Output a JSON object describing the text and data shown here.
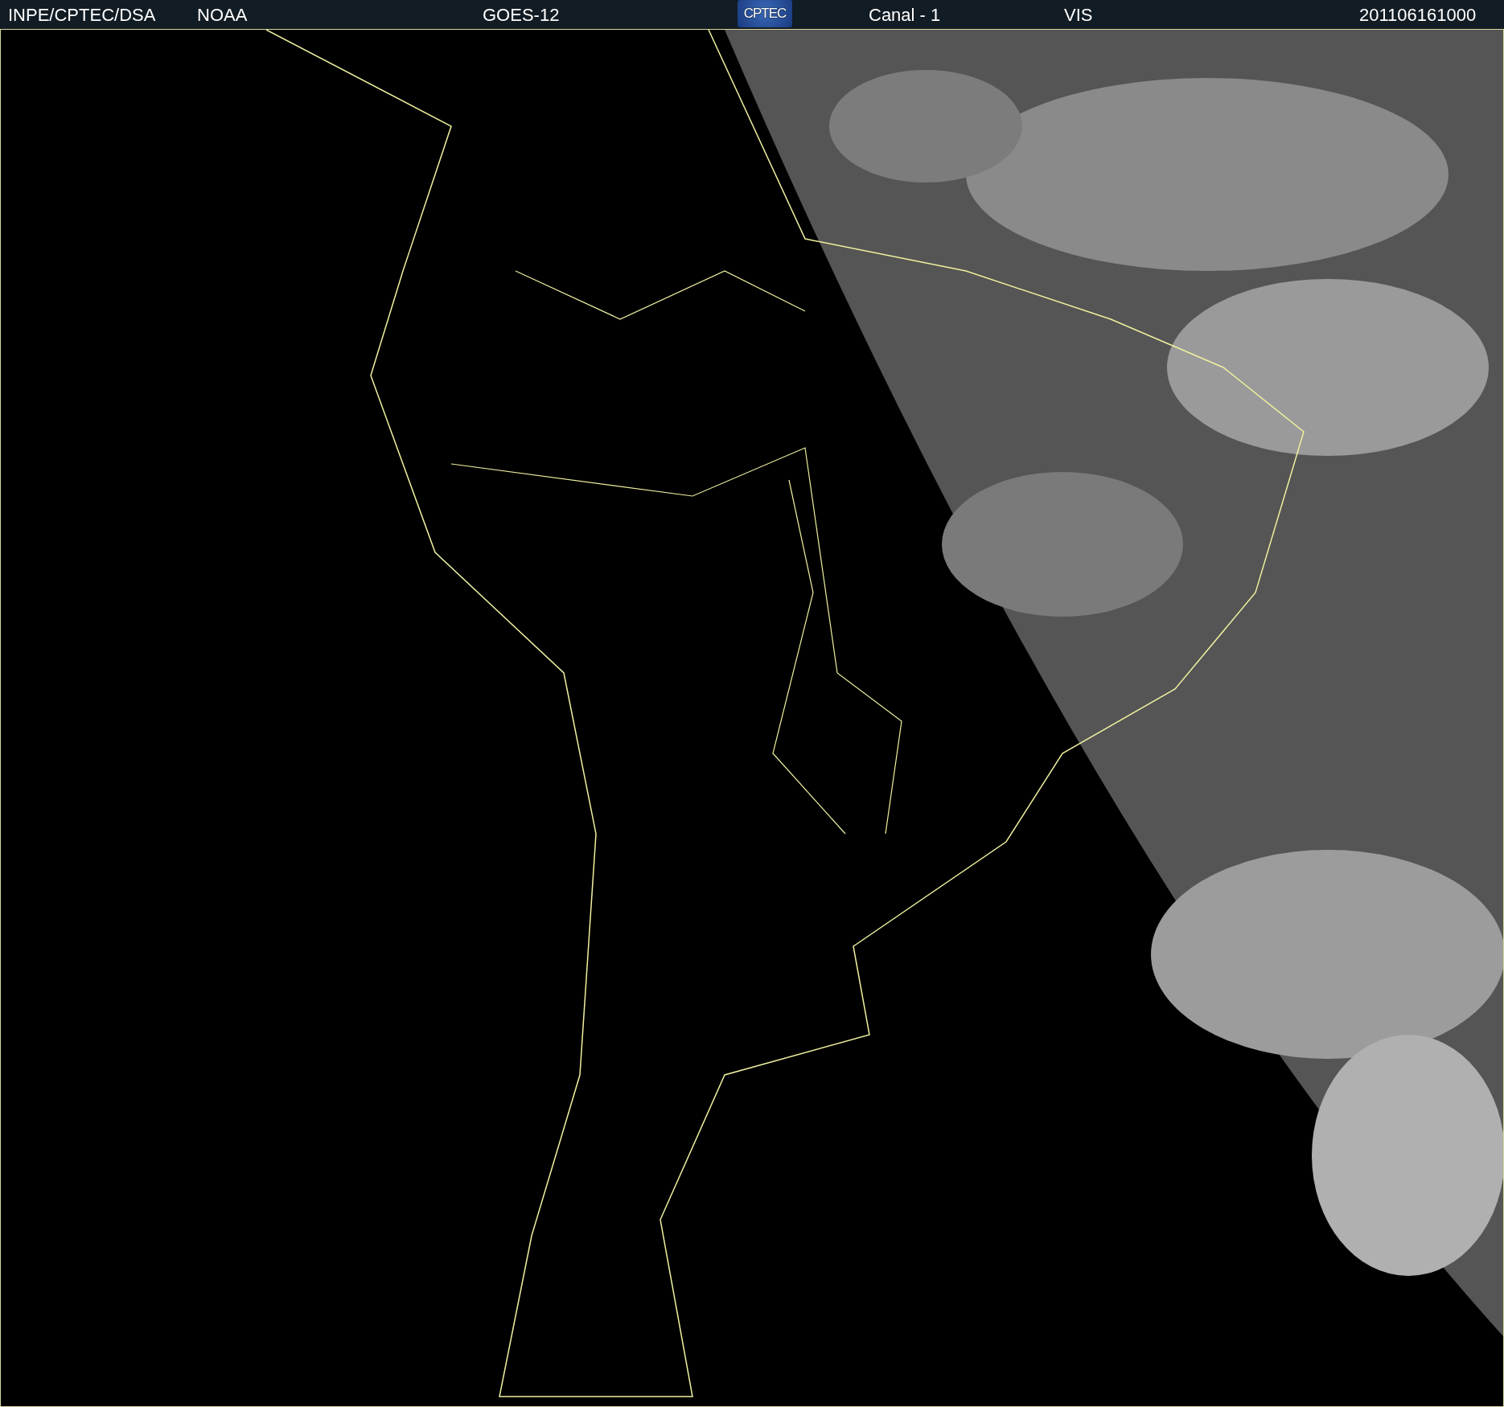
{
  "header": {
    "items": [
      {
        "kind": "text",
        "text": "INPE/CPTEC/DSA"
      },
      {
        "kind": "text",
        "text": "NOAA"
      },
      {
        "kind": "text",
        "text": "GOES-12"
      },
      {
        "kind": "logo",
        "text": "CPTEC"
      },
      {
        "kind": "text",
        "text": "Canal - 1"
      },
      {
        "kind": "text",
        "text": "VIS"
      },
      {
        "kind": "text",
        "text": "201106161000"
      }
    ]
  }
}
